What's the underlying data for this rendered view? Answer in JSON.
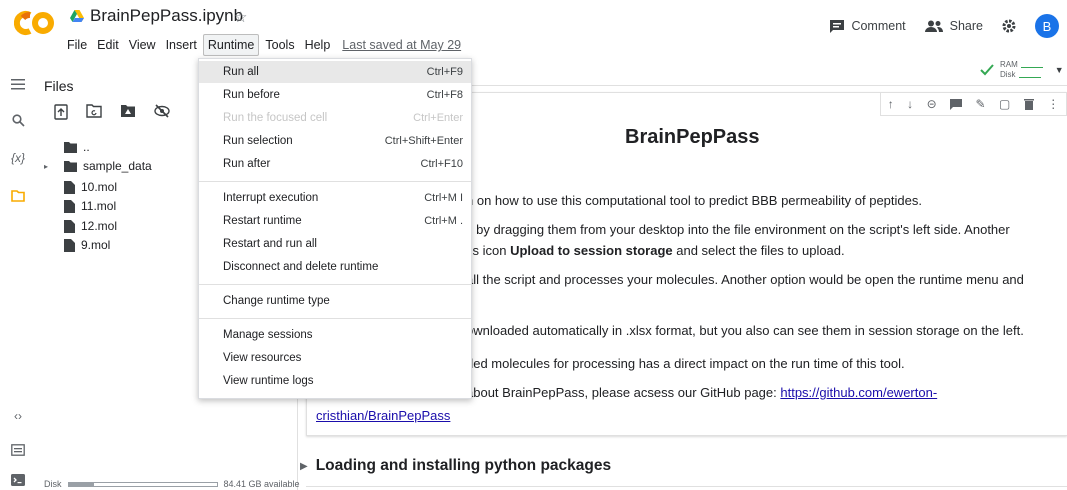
{
  "app": {
    "title": "BrainPepPass.ipynb",
    "last_saved": "Last saved at May 29",
    "logo_text": "CO"
  },
  "menubar": [
    "File",
    "Edit",
    "View",
    "Insert",
    "Runtime",
    "Tools",
    "Help"
  ],
  "header_right": {
    "comment": "Comment",
    "share": "Share",
    "avatar": "B"
  },
  "resources": {
    "ram": "RAM",
    "disk": "Disk"
  },
  "files_panel": {
    "title": "Files",
    "items": [
      {
        "name": "..",
        "type": "folder-up"
      },
      {
        "name": "sample_data",
        "type": "folder"
      },
      {
        "name": "10.mol",
        "type": "file"
      },
      {
        "name": "11.mol",
        "type": "file"
      },
      {
        "name": "12.mol",
        "type": "file"
      },
      {
        "name": "9.mol",
        "type": "file"
      }
    ],
    "disk_label": "Disk",
    "disk_available": "84.41 GB available",
    "disk_used_fraction": 0.17
  },
  "runtime_menu": {
    "items": [
      {
        "label": "Run all",
        "shortcut": "Ctrl+F9",
        "state": "highlight"
      },
      {
        "label": "Run before",
        "shortcut": "Ctrl+F8",
        "state": "normal"
      },
      {
        "label": "Run the focused cell",
        "shortcut": "Ctrl+Enter",
        "state": "disabled"
      },
      {
        "label": "Run selection",
        "shortcut": "Ctrl+Shift+Enter",
        "state": "normal"
      },
      {
        "label": "Run after",
        "shortcut": "Ctrl+F10",
        "state": "normal"
      },
      {
        "label": "Interrupt execution",
        "shortcut": "Ctrl+M I",
        "state": "normal"
      },
      {
        "label": "Restart runtime",
        "shortcut": "Ctrl+M .",
        "state": "normal"
      },
      {
        "label": "Restart and run all",
        "shortcut": "",
        "state": "normal"
      },
      {
        "label": "Disconnect and delete runtime",
        "shortcut": "",
        "state": "normal"
      },
      {
        "label": "Change runtime type",
        "shortcut": "",
        "state": "normal"
      },
      {
        "label": "Manage sessions",
        "shortcut": "",
        "state": "normal"
      },
      {
        "label": "View resources",
        "shortcut": "",
        "state": "normal"
      },
      {
        "label": "View runtime logs",
        "shortcut": "",
        "state": "normal"
      }
    ]
  },
  "notebook": {
    "heading": "BrainPepPass",
    "line1": "n on how to use this computational tool to predict BBB permeability of peptides.",
    "line2": "s by dragging them from your desktop into the file environment on the script's left side. Another",
    "line3_pre": "ss icon ",
    "line3_bold": "Upload to session storage",
    "line3_post": " and select the files to upload.",
    "line4": "all the script and processes your molecules. Another option would be open the runtime menu and",
    "line5": "ownloaded automatically in .xlsx format, but you also can see them in session storage on the left.",
    "line6": "ded molecules for processing has a direct impact on the run time of this tool.",
    "line7_pre": "about BrainPepPass, please acsess our GitHub page: ",
    "line7_link": "https://github.com/ewerton-",
    "line8_link": "cristhian/BrainPepPass",
    "section2": "Loading and installing python packages"
  },
  "colors": {
    "accent_orange": "#f9ab00",
    "link_blue": "#1a0dab",
    "avatar_blue": "#1a73e8",
    "ram_green": "#34a853"
  }
}
